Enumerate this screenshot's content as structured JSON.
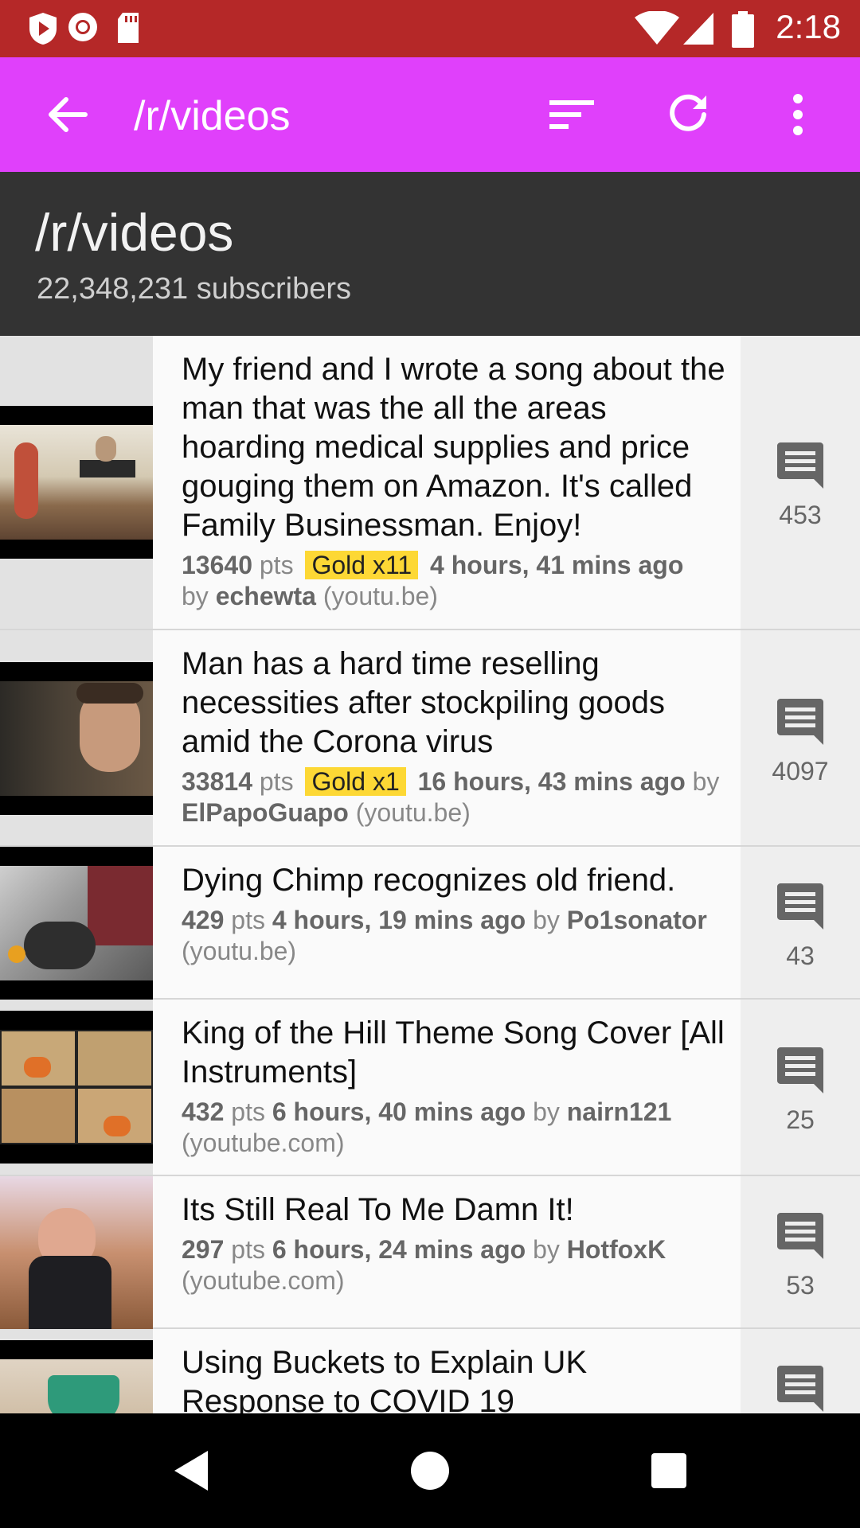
{
  "status_bar": {
    "time": "2:18"
  },
  "app_bar": {
    "title": "/r/videos"
  },
  "subreddit": {
    "name": "/r/videos",
    "subscribers": "22,348,231 subscribers"
  },
  "posts": [
    {
      "title": "My friend and I wrote a song about the man that was the all the areas hoarding medical supplies and price gouging them on Amazon. It's called Family Businessman. Enjoy!",
      "points": "13640",
      "pts_label": "pts",
      "gold": "Gold x11",
      "age": "4 hours, 41 mins ago",
      "by_label": "by",
      "author": "echewta",
      "domain": "(youtu.be)",
      "comments": "453"
    },
    {
      "title": "Man has a hard time reselling necessities after stockpiling goods amid the Corona virus",
      "points": "33814",
      "pts_label": "pts",
      "gold": "Gold x1",
      "age": "16 hours, 43 mins ago",
      "by_label": "by",
      "author": "ElPapoGuapo",
      "domain": "(youtu.be)",
      "comments": "4097"
    },
    {
      "title": "Dying Chimp recognizes old friend.",
      "points": "429",
      "pts_label": "pts",
      "age": "4 hours, 19 mins ago",
      "by_label": "by",
      "author": "Po1sonator",
      "domain": "(youtu.be)",
      "comments": "43"
    },
    {
      "title": "King of the Hill Theme Song Cover [All Instruments]",
      "points": "432",
      "pts_label": "pts",
      "age": "6 hours, 40 mins ago",
      "by_label": "by",
      "author": "nairn121",
      "domain": "(youtube.com)",
      "comments": "25"
    },
    {
      "title": "Its Still Real To Me Damn It!",
      "points": "297",
      "pts_label": "pts",
      "age": "6 hours, 24 mins ago",
      "by_label": "by",
      "author": "HotfoxK",
      "domain": "(youtube.com)",
      "comments": "53"
    },
    {
      "title": "Using Buckets to Explain UK Response to COVID 19"
    }
  ],
  "colors": {
    "status_bar": "#b52828",
    "app_bar": "#e040fb",
    "header": "#333333",
    "gold": "#fdd835"
  },
  "icons": [
    "back-arrow-icon",
    "sort-icon",
    "refresh-icon",
    "more-vert-icon",
    "comment-icon",
    "nav-back-icon",
    "nav-home-icon",
    "nav-recents-icon"
  ]
}
